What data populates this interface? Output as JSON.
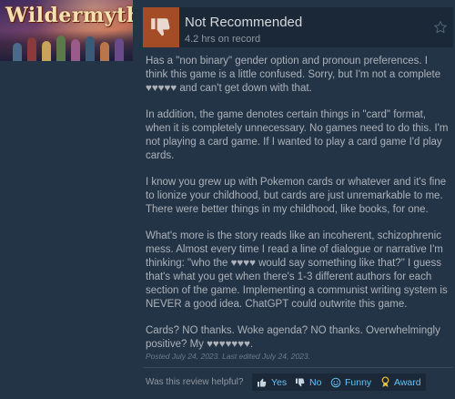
{
  "game": {
    "title": "Wildermyth"
  },
  "review": {
    "verdict": "Not Recommended",
    "hours": "4.2 hrs on record",
    "paragraphs": [
      "Has a \"non binary\" gender option and pronoun preferences. I think this game is a little confused. Sorry, but I'm not a complete ♥♥♥♥♥ and can't get down with that.",
      "In addition, the game denotes certain things in \"card\" format, when it is completely unnecessary. No games need to do this. I'm not playing a card game. If I wanted to play a card game I'd play cards.",
      "I know you grew up with Pokemon cards or whatever and it's fine to lionize your childhood, but cards are just unremarkable to me. There were better things in my childhood, like books, for one.",
      "What's more is the story reads like an incoherent, schizophrenic mess. Almost every time I read a line of dialogue or narrative I'm thinking: \"who the ♥♥♥♥ would say something like that?\" I guess that's what you get when there's 1-3 different authors for each section of the game. Implementing a communist writing system is NEVER a good idea. ChatGPT could outwrite this game.",
      "Cards? NO thanks. Woke agenda? NO thanks. Overwhelmingly positive? My ♥♥♥♥♥♥♥."
    ],
    "posted": "Posted July 24, 2023. Last edited July 24, 2023."
  },
  "feedback": {
    "prompt": "Was this review helpful?",
    "yes_label": "Yes",
    "no_label": "No",
    "funny_label": "Funny",
    "award_label": "Award"
  },
  "colors": {
    "page_bg": "#243447",
    "header_bg": "#1b2838",
    "thumb_down_bg": "#a34c25",
    "link_blue": "#66c0f4",
    "award_yellow": "#e8c23a"
  },
  "icons": {
    "verdict": "thumbs-down-icon",
    "star": "star-outline-icon",
    "yes": "thumbs-up-icon",
    "no": "thumbs-down-icon",
    "funny": "smiley-icon",
    "award": "award-ribbon-icon"
  }
}
